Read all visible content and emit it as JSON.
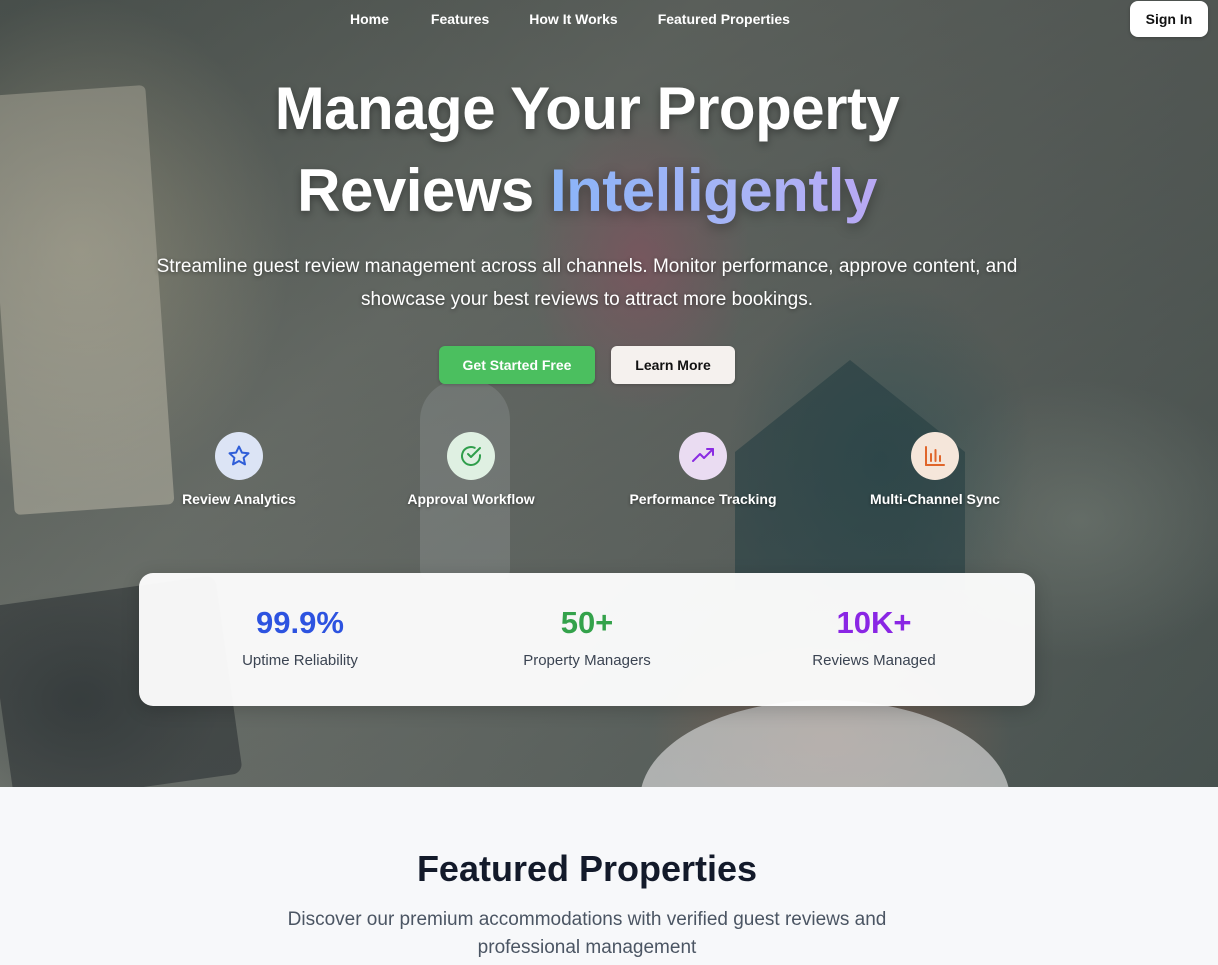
{
  "nav": {
    "links": [
      "Home",
      "Features",
      "How It Works",
      "Featured Properties"
    ],
    "signin_label": "Sign In"
  },
  "hero": {
    "title_line1": "Manage Your Property",
    "title_line2_plain": "Reviews",
    "title_line2_accent": "Intelligently",
    "subtitle": "Streamline guest review management across all channels. Monitor performance, approve content, and showcase your best reviews to attract more bookings.",
    "cta_primary": "Get Started Free",
    "cta_secondary": "Learn More"
  },
  "features": [
    {
      "label": "Review Analytics",
      "icon": "star-icon",
      "bg": "#dce4f5",
      "color": "#2f5ed8"
    },
    {
      "label": "Approval Workflow",
      "icon": "check-circle-icon",
      "bg": "#dff0e2",
      "color": "#2f9e4b"
    },
    {
      "label": "Performance Tracking",
      "icon": "trending-up-icon",
      "bg": "#eadcf2",
      "color": "#8a2be2"
    },
    {
      "label": "Multi-Channel Sync",
      "icon": "bar-chart-icon",
      "bg": "#f5e6da",
      "color": "#e0652a"
    }
  ],
  "stats": [
    {
      "value": "99.9%",
      "label": "Uptime Reliability",
      "color": "#2d53e0"
    },
    {
      "value": "50+",
      "label": "Property Managers",
      "color": "#34a24b"
    },
    {
      "value": "10K+",
      "label": "Reviews Managed",
      "color": "#8a26e4"
    }
  ],
  "featured": {
    "title": "Featured Properties",
    "subtitle": "Discover our premium accommodations with verified guest reviews and professional management"
  }
}
